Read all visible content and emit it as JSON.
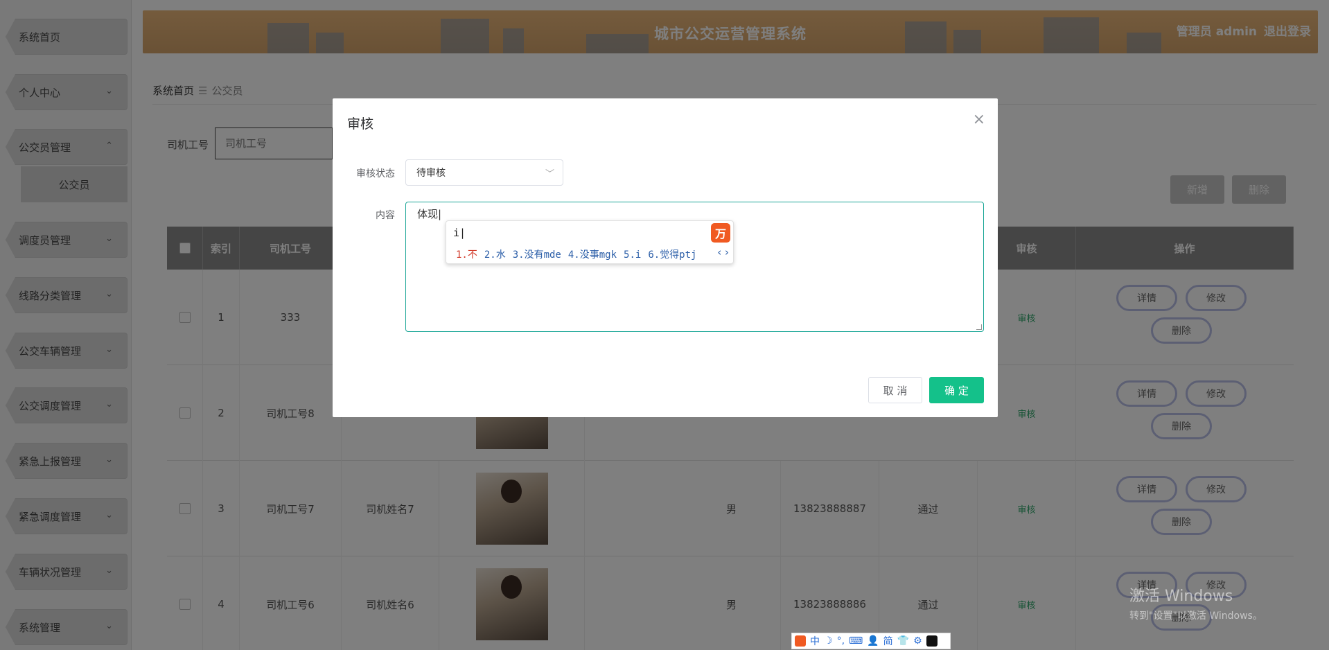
{
  "sidebar": {
    "items": [
      {
        "label": "系统首页",
        "chevron": ""
      },
      {
        "label": "个人中心",
        "chevron": "⌄"
      },
      {
        "label": "公交员管理",
        "chevron": "⌃"
      },
      {
        "label": "调度员管理",
        "chevron": "⌄"
      },
      {
        "label": "线路分类管理",
        "chevron": "⌄"
      },
      {
        "label": "公交车辆管理",
        "chevron": "⌄"
      },
      {
        "label": "公交调度管理",
        "chevron": "⌄"
      },
      {
        "label": "紧急上报管理",
        "chevron": "⌄"
      },
      {
        "label": "紧急调度管理",
        "chevron": "⌄"
      },
      {
        "label": "车辆状况管理",
        "chevron": "⌄"
      },
      {
        "label": "系统管理",
        "chevron": "⌄"
      }
    ],
    "sub_item": "公交员"
  },
  "header": {
    "title": "城市公交运营管理系统",
    "user": "管理员 admin",
    "logout": "退出登录"
  },
  "breadcrumb": {
    "home": "系统首页",
    "sep": "☰",
    "current": "公交员"
  },
  "search": {
    "label": "司机工号",
    "placeholder": "司机工号"
  },
  "toolbar": {
    "add_label": "新增",
    "delete_label": "删除"
  },
  "table": {
    "headers": [
      "索引",
      "司机工号",
      "",
      "",
      "",
      "",
      "",
      "",
      "审核",
      "操作"
    ],
    "rows": [
      {
        "index": "1",
        "driver_id": "333",
        "name": "",
        "gender": "",
        "phone": "",
        "status": "",
        "audit": "审核"
      },
      {
        "index": "2",
        "driver_id": "司机工号8",
        "name": "",
        "gender": "",
        "phone": "",
        "status": "",
        "audit": "审核"
      },
      {
        "index": "3",
        "driver_id": "司机工号7",
        "name": "司机姓名7",
        "gender": "男",
        "phone": "13823888887",
        "status": "通过",
        "audit": "审核"
      },
      {
        "index": "4",
        "driver_id": "司机工号6",
        "name": "司机姓名6",
        "gender": "男",
        "phone": "13823888886",
        "status": "通过",
        "audit": "审核"
      }
    ],
    "ops": {
      "detail": "详情",
      "edit": "修改",
      "delete": "删除"
    }
  },
  "dialog": {
    "title": "审核",
    "close": "×",
    "status_label": "审核状态",
    "status_value": "待审核",
    "content_label": "内容",
    "content_value": "体现",
    "cancel": "取 消",
    "confirm": "确 定"
  },
  "ime": {
    "input": "i",
    "candidates": [
      "1.不",
      "2.水",
      "3.没有mde",
      "4.没事mgk",
      "5.i",
      "6.觉得ptj"
    ],
    "logo": "万"
  },
  "ime_bar": {
    "items": [
      "中",
      "☽",
      "°,",
      "⌨",
      "👤",
      "简",
      "👕",
      "⚙"
    ]
  },
  "watermark": {
    "line1": "激活 Windows",
    "line2": "转到\"设置\"以激活 Windows。"
  },
  "colors": {
    "accent": "#14c18a",
    "focus": "#1aa696",
    "ime_brand": "#f05a22"
  }
}
